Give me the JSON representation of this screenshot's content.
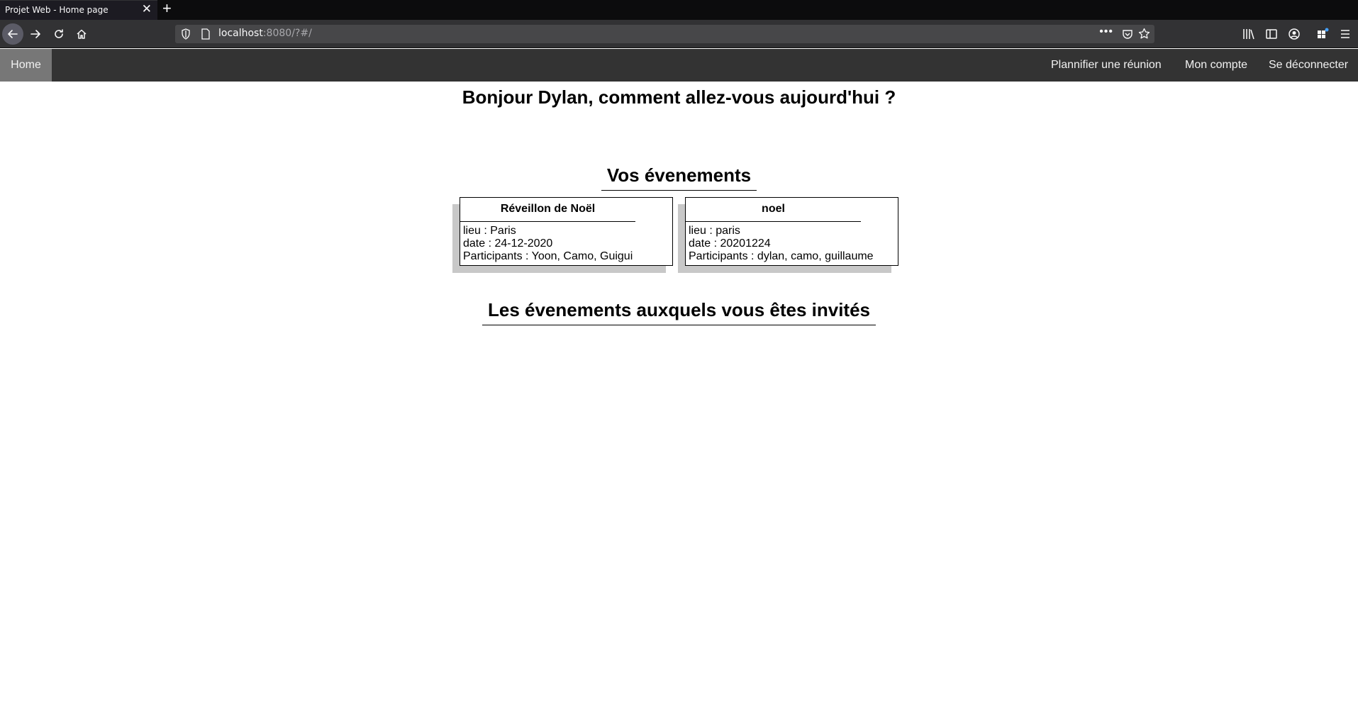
{
  "browser": {
    "tab_title": "Projet Web - Home page",
    "url_host": "localhost",
    "url_rest": ":8080/?#/"
  },
  "site_nav": {
    "home": "Home",
    "plan_meeting": "Plannifier une réunion",
    "my_account": "Mon compte",
    "logout": "Se déconnecter"
  },
  "greeting": "Bonjour Dylan, comment allez-vous aujourd'hui ?",
  "own_events": {
    "title": "Vos évenements",
    "events": [
      {
        "name": "Réveillon de Noël",
        "place": "lieu : Paris",
        "date": "date : 24-12-2020",
        "participants": "Participants : Yoon, Camo, Guigui"
      },
      {
        "name": "noel",
        "place": "lieu : paris",
        "date": "date : 20201224",
        "participants": "Participants : dylan, camo, guillaume"
      }
    ]
  },
  "invited_events": {
    "title": "Les évenements auxquels vous êtes invités"
  }
}
